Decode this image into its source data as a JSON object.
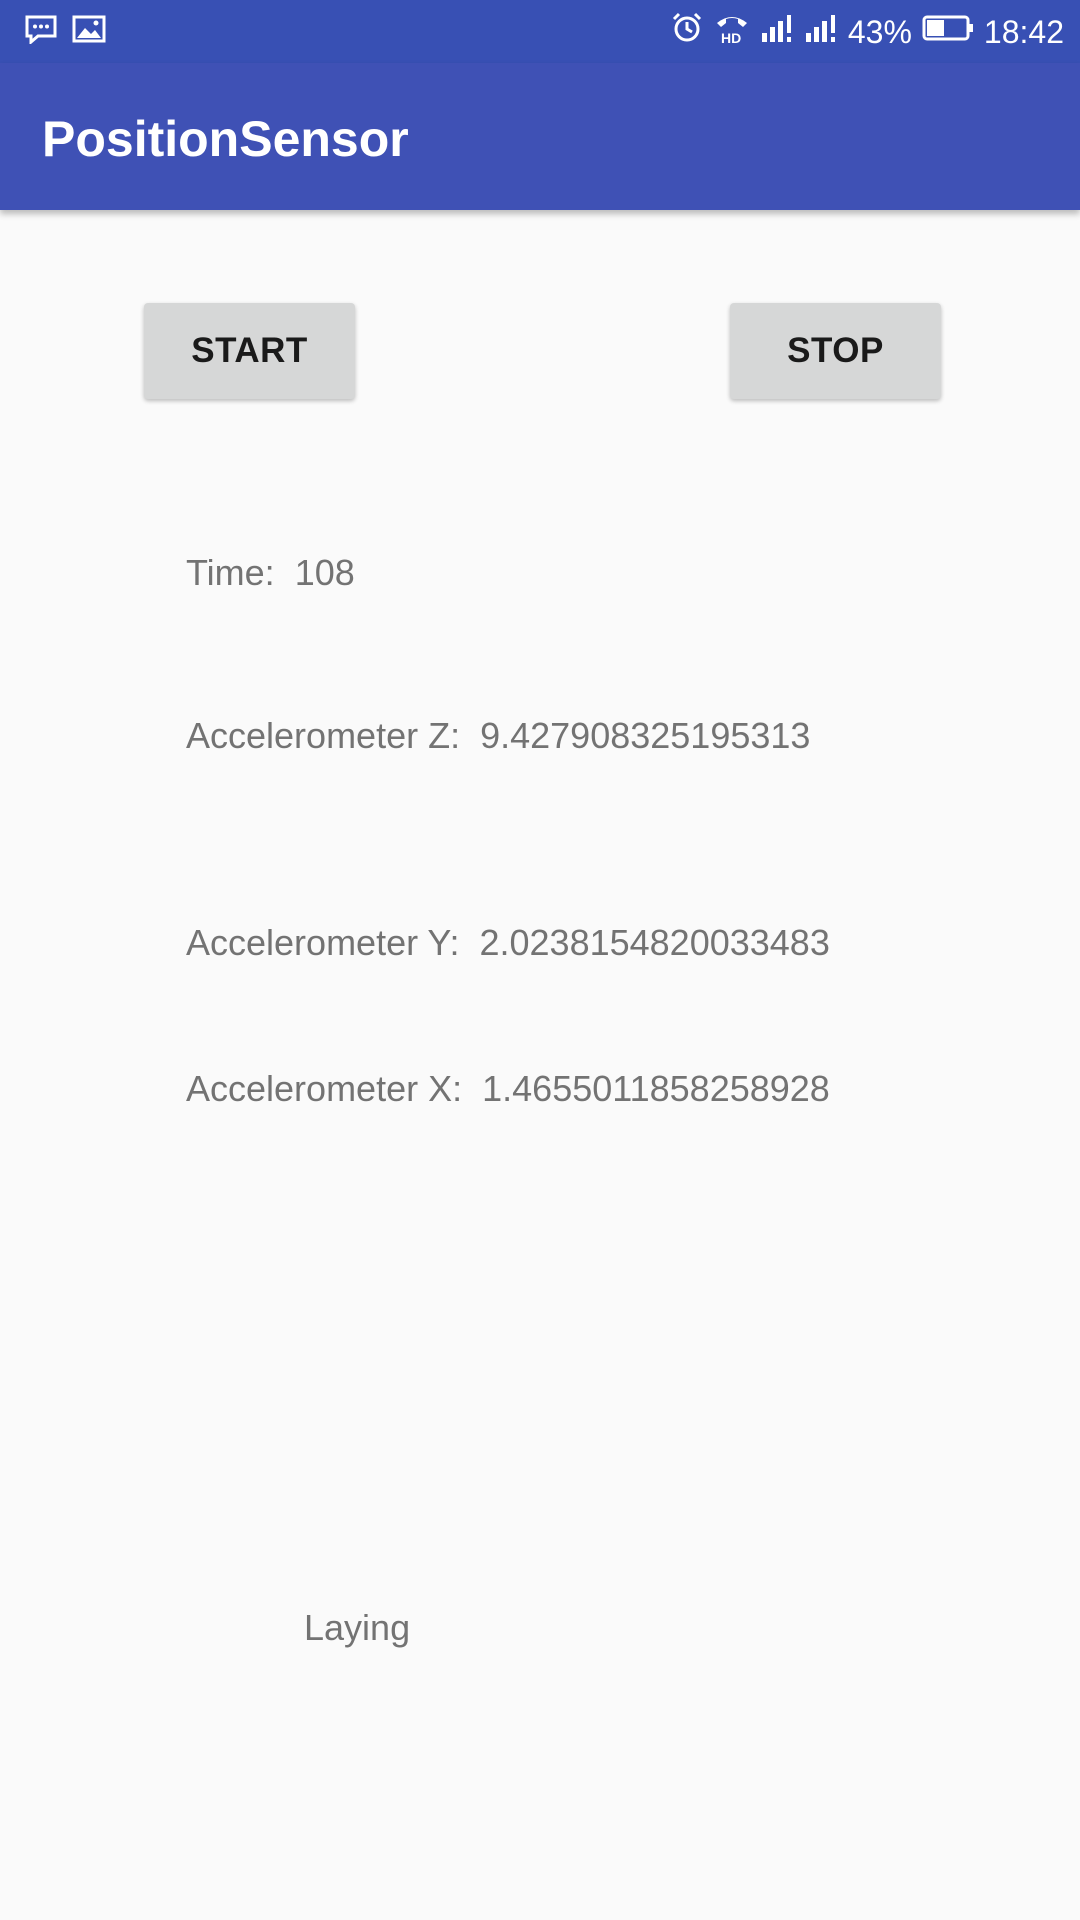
{
  "status_bar": {
    "notifications": [
      "message-icon",
      "image-icon"
    ],
    "indicators": [
      "alarm-icon",
      "hd-call-icon",
      "signal-icon",
      "signal-icon"
    ],
    "battery_percent": "43%",
    "time": "18:42"
  },
  "app_bar": {
    "title": "PositionSensor"
  },
  "controls": {
    "start_label": "START",
    "stop_label": "STOP"
  },
  "readings": {
    "time_label": "Time:",
    "time_value": "108",
    "accel_z_label": "Accelerometer Z:",
    "accel_z_value": "9.427908325195313",
    "accel_y_label": "Accelerometer Y:",
    "accel_y_value": "2.0238154820033483",
    "accel_x_label": "Accelerometer X:",
    "accel_x_value": "1.4655011858258928"
  },
  "state": {
    "posture": "Laying"
  },
  "colors": {
    "app_bar": "#3f51b5",
    "status_bar": "#3850b4",
    "background": "#fafafa",
    "button": "#d6d7d7",
    "text_secondary": "#737373"
  }
}
